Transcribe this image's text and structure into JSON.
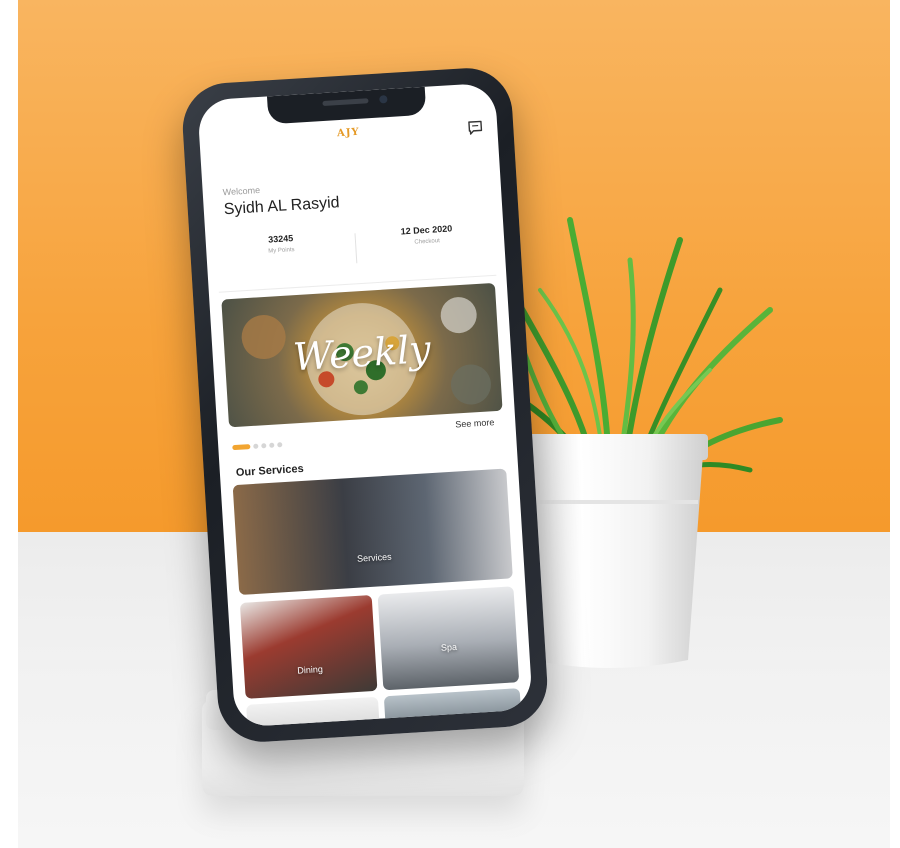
{
  "app": {
    "logo_text": "AJY",
    "chat_icon": "chat-icon"
  },
  "welcome": {
    "label": "Welcome",
    "name": "Syidh AL Rasyid"
  },
  "stats": [
    {
      "value": "33245",
      "label": "My Points"
    },
    {
      "value": "12 Dec 2020",
      "label": "Checkout"
    }
  ],
  "banner": {
    "title": "Weekly",
    "see_more": "See more",
    "carousel_dots": 5,
    "active_dot": 1
  },
  "services": {
    "title": "Our Services",
    "tiles": [
      {
        "label": "Services"
      },
      {
        "label": "Dining"
      },
      {
        "label": "Spa"
      }
    ]
  },
  "colors": {
    "accent": "#f2a531",
    "background": "#f7a33c"
  }
}
